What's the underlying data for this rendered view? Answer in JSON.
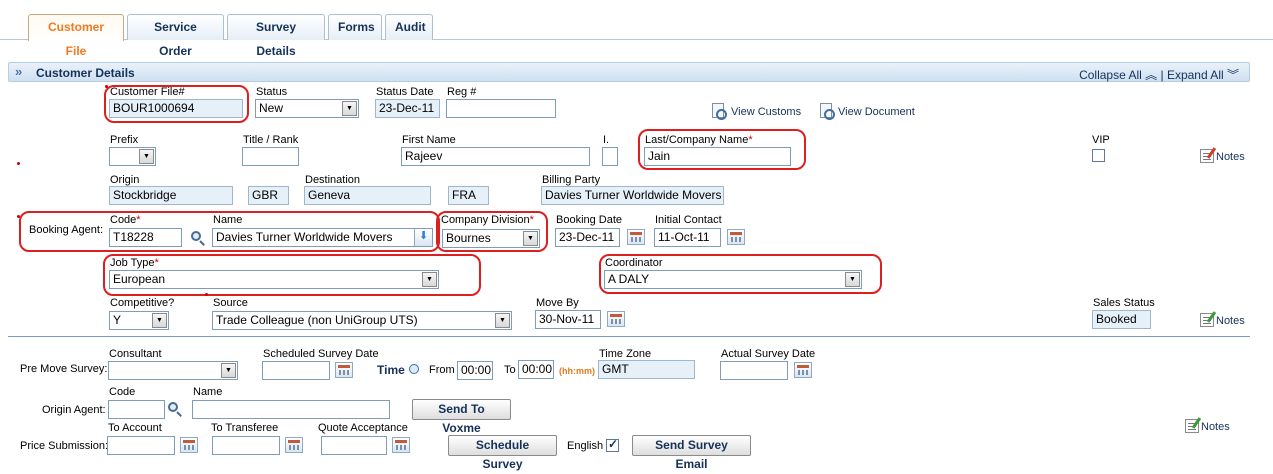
{
  "tabs": [
    "Customer File",
    "Service Order",
    "Survey Details",
    "Forms",
    "Audit"
  ],
  "section": {
    "title": "Customer Details",
    "collapse_all": "Collapse All",
    "separator": "|",
    "expand_all": "Expand All"
  },
  "row1": {
    "customer_file_label": "Customer File#",
    "customer_file_value": "BOUR1000694",
    "status_label": "Status",
    "status_value": "New",
    "status_date_label": "Status Date",
    "status_date_value": "23-Dec-11",
    "reg_label": "Reg #",
    "reg_value": "",
    "view_customs": "View Customs",
    "view_document": "View Document"
  },
  "row2": {
    "prefix_label": "Prefix",
    "prefix_value": "",
    "title_rank_label": "Title / Rank",
    "title_rank_value": "",
    "first_name_label": "First Name",
    "first_name_value": "Rajeev",
    "initial_label": "I.",
    "initial_value": "",
    "last_name_label": "Last/Company Name",
    "last_name_value": "Jain",
    "vip_label": "VIP",
    "notes": "Notes"
  },
  "row3": {
    "origin_label": "Origin",
    "origin_city": "Stockbridge",
    "origin_country": "GBR",
    "destination_label": "Destination",
    "destination_city": "Geneva",
    "destination_country": "FRA",
    "billing_party_label": "Billing Party",
    "billing_party_value": "Davies Turner Worldwide Movers"
  },
  "row4": {
    "booking_agent_label": "Booking Agent:",
    "code_label": "Code",
    "code_value": "T18228",
    "name_label": "Name",
    "name_value": "Davies Turner Worldwide Movers",
    "company_division_label": "Company Division",
    "company_division_value": "Bournes",
    "booking_date_label": "Booking Date",
    "booking_date_value": "23-Dec-11",
    "initial_contact_label": "Initial Contact",
    "initial_contact_value": "11-Oct-11"
  },
  "row5": {
    "job_type_label": "Job Type",
    "job_type_value": "European",
    "coordinator_label": "Coordinator",
    "coordinator_value": "A DALY"
  },
  "row6": {
    "competitive_label": "Competitive?",
    "competitive_value": "Y",
    "source_label": "Source",
    "source_value": "Trade Colleague (non UniGroup UTS)",
    "move_by_label": "Move By",
    "move_by_value": "30-Nov-11",
    "sales_status_label": "Sales Status",
    "sales_status_value": "Booked",
    "notes": "Notes"
  },
  "survey": {
    "pre_move_label": "Pre Move Survey:",
    "consultant_label": "Consultant",
    "consultant_value": "",
    "scheduled_label": "Scheduled Survey Date",
    "scheduled_value": "",
    "time_label": "Time",
    "from_label": "From",
    "from_value": "00:00",
    "to_label": "To",
    "to_value": "00:00",
    "hhmm": "(hh:mm)",
    "timezone_label": "Time Zone",
    "timezone_value": "GMT",
    "actual_label": "Actual Survey Date",
    "actual_value": ""
  },
  "origin_agent": {
    "label": "Origin Agent:",
    "code_label": "Code",
    "code_value": "",
    "name_label": "Name",
    "name_value": "",
    "send_voxme": "Send To Voxme"
  },
  "price": {
    "label": "Price Submission:",
    "to_account_label": "To Account",
    "to_account_value": "",
    "to_transferee_label": "To Transferee",
    "to_transferee_value": "",
    "quote_label": "Quote Acceptance",
    "quote_value": "",
    "schedule_survey": "Schedule Survey",
    "english_label": "English",
    "send_email": "Send Survey Email",
    "notes": "Notes"
  }
}
